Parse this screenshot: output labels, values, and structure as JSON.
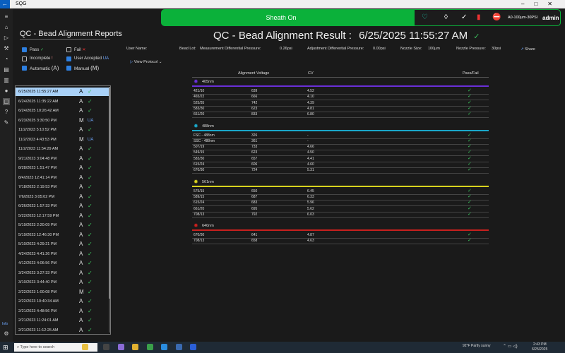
{
  "window": {
    "title": "SQG"
  },
  "sheath": {
    "label": "Sheath On",
    "config": "A0-100µm-30PSI",
    "user": "admin"
  },
  "reports": {
    "title": "QC - Bead Alignment Reports",
    "filters": {
      "pass": "Pass",
      "fail": "Fail",
      "incomplete": "Incomplete",
      "user_accepted": "User Accepted",
      "user_accepted_short": "UA",
      "automatic": "Automatic",
      "automatic_code": "(A)",
      "manual": "Manual",
      "manual_code": "(M)"
    },
    "items": [
      {
        "date": "6/25/2025 11:55:27 AM",
        "mode": "A",
        "status": "✓"
      },
      {
        "date": "6/24/2025 11:35:22 AM",
        "mode": "A",
        "status": "✓"
      },
      {
        "date": "6/24/2025 10:26:42 AM",
        "mode": "A",
        "status": "✓"
      },
      {
        "date": "6/23/2025 3:30:50 PM",
        "mode": "M",
        "status": "UA"
      },
      {
        "date": "11/2/2023 5:10:52 PM",
        "mode": "A",
        "status": "✓"
      },
      {
        "date": "11/2/2023 4:43:53 PM",
        "mode": "M",
        "status": "UA"
      },
      {
        "date": "11/2/2023 11:54:29 AM",
        "mode": "A",
        "status": "✓"
      },
      {
        "date": "9/21/2023 3:04:48 PM",
        "mode": "A",
        "status": "✓"
      },
      {
        "date": "8/28/2023 1:51:47 PM",
        "mode": "A",
        "status": "✓"
      },
      {
        "date": "8/4/2023 12:41:14 PM",
        "mode": "A",
        "status": "✓"
      },
      {
        "date": "7/18/2023 2:19:53 PM",
        "mode": "A",
        "status": "✓"
      },
      {
        "date": "7/6/2023 3:05:02 PM",
        "mode": "A",
        "status": "✓"
      },
      {
        "date": "6/26/2023 1:57:33 PM",
        "mode": "A",
        "status": "✓"
      },
      {
        "date": "5/22/2023 12:17:59 PM",
        "mode": "A",
        "status": "✓"
      },
      {
        "date": "5/19/2023 2:20:09 PM",
        "mode": "A",
        "status": "✓"
      },
      {
        "date": "5/19/2023 12:46:30 PM",
        "mode": "A",
        "status": "✓"
      },
      {
        "date": "5/10/2023 4:29:21 PM",
        "mode": "A",
        "status": "✓"
      },
      {
        "date": "4/24/2023 4:41:26 PM",
        "mode": "A",
        "status": "✓"
      },
      {
        "date": "4/12/2023 4:06:56 PM",
        "mode": "A",
        "status": "✓"
      },
      {
        "date": "3/24/2023 3:27:33 PM",
        "mode": "A",
        "status": "✓"
      },
      {
        "date": "3/10/2023 3:44:40 PM",
        "mode": "A",
        "status": "✓"
      },
      {
        "date": "2/22/2023 1:00:08 PM",
        "mode": "M",
        "status": "✓"
      },
      {
        "date": "2/22/2023 10:40:34 AM",
        "mode": "A",
        "status": "✓"
      },
      {
        "date": "2/21/2023 4:48:56 PM",
        "mode": "A",
        "status": "✓"
      },
      {
        "date": "2/21/2023 11:24:01 AM",
        "mode": "A",
        "status": "✓"
      },
      {
        "date": "2/21/2023 11:12:25 AM",
        "mode": "A",
        "status": "✓"
      }
    ]
  },
  "result": {
    "title": "QC - Bead Alignment Result :",
    "timestamp": "6/25/2025 11:55:27 AM",
    "user_name_label": "User Name:",
    "bead_lot_label": "Bead Lot:",
    "mdp_label": "Measurement Differential Pressure:",
    "mdp_value": "0.26psi",
    "adp_label": "Adjustment Differential Pressure:",
    "adp_value": "0.00psi",
    "nozzle_size_label": "Nozzle Size:",
    "nozzle_size_value": "100µm",
    "nozzle_pressure_label": "Nozzle Pressure:",
    "nozzle_pressure_value": "30psi",
    "share": "Share",
    "protocol": "View Protocol",
    "columns": {
      "voltage": "Alignment Voltage",
      "cv": "CV",
      "pf": "Pass/Fail"
    },
    "lasers": [
      {
        "name": "405nm",
        "color": "#6a2fd8",
        "rows": [
          {
            "ch": "421/10",
            "v": "639",
            "cv": "4.52"
          },
          {
            "ch": "465/22",
            "v": "666",
            "cv": "4.10"
          },
          {
            "ch": "525/35",
            "v": "742",
            "cv": "4.39"
          },
          {
            "ch": "583/30",
            "v": "623",
            "cv": "4.81"
          },
          {
            "ch": "661/20",
            "v": "833",
            "cv": "6.80"
          }
        ]
      },
      {
        "name": "488nm",
        "color": "#1aa7c9",
        "rows": [
          {
            "ch": "FSC - 488nm",
            "v": "326",
            "cv": "-"
          },
          {
            "ch": "SSC - 488nm",
            "v": "361",
            "cv": "-"
          },
          {
            "ch": "507/19",
            "v": "733",
            "cv": "4.66"
          },
          {
            "ch": "549/15",
            "v": "623",
            "cv": "4.50"
          },
          {
            "ch": "583/30",
            "v": "657",
            "cv": "4.41"
          },
          {
            "ch": "615/24",
            "v": "606",
            "cv": "4.60"
          },
          {
            "ch": "670/30",
            "v": "724",
            "cv": "5.31"
          }
        ]
      },
      {
        "name": "561nm",
        "color": "#d8d21e",
        "rows": [
          {
            "ch": "575/15",
            "v": "650",
            "cv": "6.45"
          },
          {
            "ch": "589/15",
            "v": "687",
            "cv": "6.33"
          },
          {
            "ch": "615/24",
            "v": "683",
            "cv": "5.96"
          },
          {
            "ch": "661/20",
            "v": "695",
            "cv": "5.62"
          },
          {
            "ch": "708/13",
            "v": "792",
            "cv": "6.03"
          }
        ]
      },
      {
        "name": "640nm",
        "color": "#c8201e",
        "rows": [
          {
            "ch": "670/30",
            "v": "641",
            "cv": "4.87"
          },
          {
            "ch": "708/13",
            "v": "658",
            "cv": "4.63"
          }
        ]
      }
    ]
  },
  "taskbar": {
    "search_placeholder": "Type here to search",
    "weather": "92°F  Partly sunny",
    "time": "2:43 PM",
    "date": "6/25/2025"
  },
  "rail": {
    "bottom_label": "Info"
  }
}
